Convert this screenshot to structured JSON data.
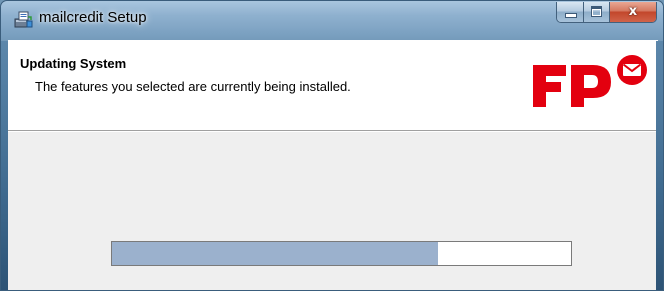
{
  "window": {
    "title": "mailcredit Setup",
    "icon": "setup-installer-icon"
  },
  "caption_buttons": {
    "minimize_icon": "minimize-icon",
    "maximize_icon": "maximize-icon",
    "close_icon": "close-icon",
    "close_glyph": "x"
  },
  "banner": {
    "title": "Updating System",
    "description": "The features you selected are currently being installed.",
    "logo": "fp-logo"
  },
  "progress": {
    "fraction": 0.71
  },
  "colors": {
    "logo_red": "#e3000f",
    "progress_fill": "#9bb1cd",
    "close_button": "#c2472c"
  }
}
